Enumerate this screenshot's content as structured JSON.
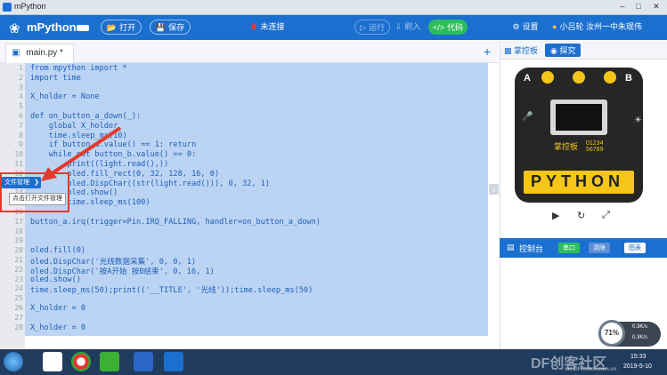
{
  "window": {
    "title": "mPython"
  },
  "toolbar": {
    "app_name": "mPython",
    "open_label": "打开",
    "save_label": "保存",
    "connection_status": "未连接",
    "run_label": "运行",
    "flash_label": "刷入",
    "code_label": "代码",
    "settings_label": "设置",
    "user_label": "小吕轮 汝州一中朱珉伟"
  },
  "editor": {
    "tab_label": "main.py *",
    "add_tab": "+",
    "line_numbers": [
      "1",
      "2",
      "3",
      "4",
      "5",
      "6",
      "7",
      "8",
      "9",
      "10",
      "11",
      "12",
      "13",
      "14",
      "15",
      "16",
      "17",
      "18",
      "19",
      "20",
      "21",
      "22",
      "23",
      "24",
      "25",
      "26",
      "27",
      "28"
    ],
    "code_lines": [
      "from mpython import *",
      "import time",
      "",
      "X_holder = None",
      "",
      "def on_button_a_down(_):",
      "    global X_holder",
      "    time.sleep_ms(10)",
      "    if button_a.value() == 1: return",
      "    while not button_b.value() == 0:",
      "        print((light.read(),))",
      "        oled.fill_rect(0, 32, 128, 16, 0)",
      "        oled.DispChar((str(light.read())), 0, 32, 1)",
      "        oled.show()",
      "        time.sleep_ms(100)",
      "",
      "button_a.irq(trigger=Pin.IRQ_FALLING, handler=on_button_a_down)",
      "",
      "",
      "oled.fill(0)",
      "oled.DispChar('光线数据采集', 0, 0, 1)",
      "oled.DispChar('按A开始 按B结束', 0, 16, 1)",
      "oled.show()",
      "time.sleep_ms(50);print(('__TITLE', '光线'));time.sleep_ms(50)",
      "",
      "X_holder = 0",
      "",
      "X_holder = 0"
    ]
  },
  "file_manager": {
    "button_label": "文件管理",
    "tooltip": "点击打开文件管理"
  },
  "right_panel": {
    "tab_controller": "掌控板",
    "tab_explore": "探究",
    "board_text": "掌控板",
    "board_serial": "01234 56789",
    "board_letters": "PYTHON",
    "btn_a": "A",
    "btn_b": "B"
  },
  "console": {
    "title": "控制台",
    "btn1": "串口",
    "btn2": "清除",
    "btn3": "图表"
  },
  "taskbar": {
    "net_percent": "71%",
    "net_up": "0.3K/s",
    "net_down": "0.3K/s",
    "time": "15:33",
    "date": "2019-5-10",
    "watermark": "DF创客社区",
    "watermark_url": "mc.DFRobot.com.cn"
  },
  "colors": {
    "accent": "#1b6fcf",
    "selection": "#bcd4f3",
    "code_run_btn": "#2dbe5c",
    "annotation_red": "#e23a2e"
  }
}
